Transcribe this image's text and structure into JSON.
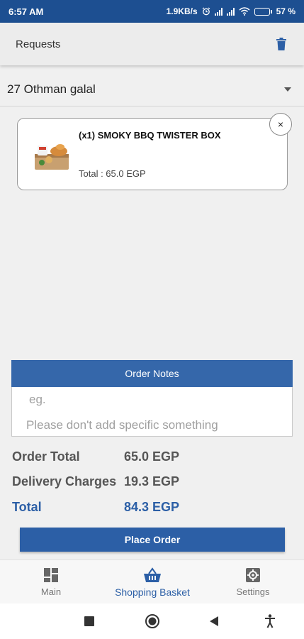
{
  "status": {
    "time": "6:57 AM",
    "speed": "1.9KB/s",
    "battery": "57",
    "battery_level": 0.57
  },
  "header": {
    "title": "Requests"
  },
  "address": {
    "value": "27 Othman galal"
  },
  "cart": {
    "items": [
      {
        "name": "(x1) SMOKY BBQ TWISTER BOX",
        "total": "Total : 65.0 EGP"
      }
    ],
    "remove_label": "×"
  },
  "notes": {
    "header": "Order Notes",
    "placeholder_line1": "eg.",
    "placeholder_line2": "Please don't add specific something"
  },
  "summary": {
    "order_total_label": "Order Total",
    "order_total_value": "65.0 EGP",
    "delivery_label": "Delivery Charges",
    "delivery_value": "19.3 EGP",
    "total_label": "Total",
    "total_value": "84.3 EGP"
  },
  "place_order": "Place Order",
  "nav": {
    "items": [
      {
        "label": "Main",
        "icon": "dashboard-icon"
      },
      {
        "label": "Shopping Basket",
        "icon": "basket-icon",
        "active": true
      },
      {
        "label": "Settings",
        "icon": "gear-icon"
      }
    ]
  },
  "colors": {
    "status_bar": "#1d4f91",
    "accent": "#2c5fa6",
    "notes_header": "#3567aa"
  }
}
